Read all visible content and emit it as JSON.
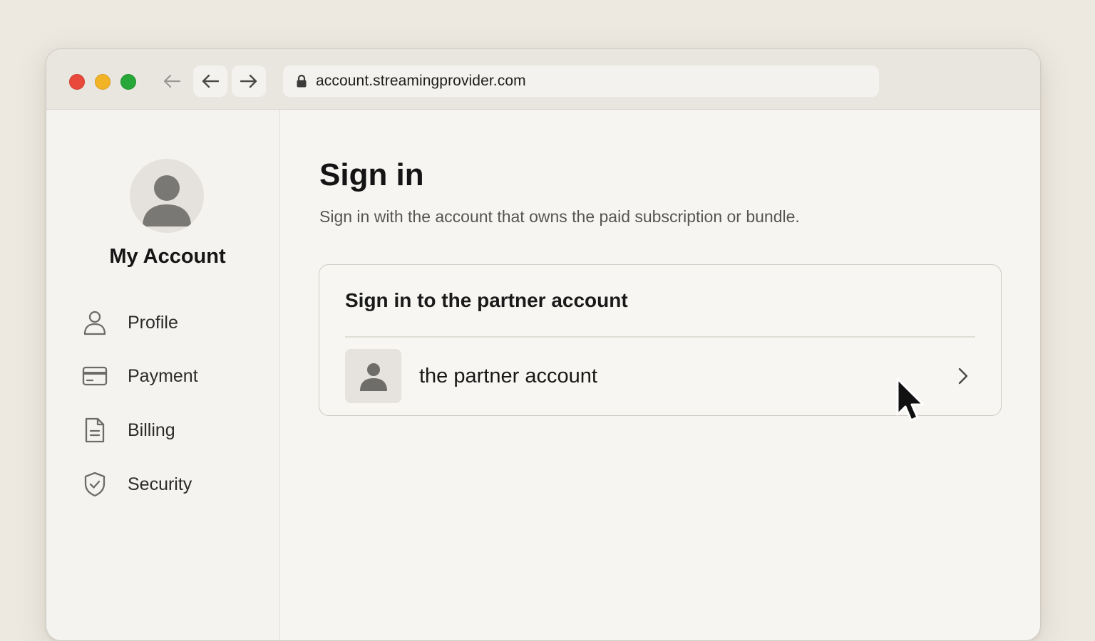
{
  "browser": {
    "url": "account.streamingprovider.com",
    "traffic_lights": {
      "close_color": "#e9493b",
      "minimize_color": "#f2b327",
      "maximize_color": "#27a737"
    }
  },
  "sidebar": {
    "title": "My Account",
    "items": [
      {
        "label": "Profile",
        "icon": "person-icon"
      },
      {
        "label": "Payment",
        "icon": "credit-card-icon"
      },
      {
        "label": "Billing",
        "icon": "document-icon"
      },
      {
        "label": "Security",
        "icon": "shield-icon"
      }
    ]
  },
  "main": {
    "title": "Sign in",
    "subtitle": "Sign in with the account that owns the paid subscription or bundle.",
    "card": {
      "title": "Sign in to the partner account",
      "account_label": "the partner account"
    }
  }
}
